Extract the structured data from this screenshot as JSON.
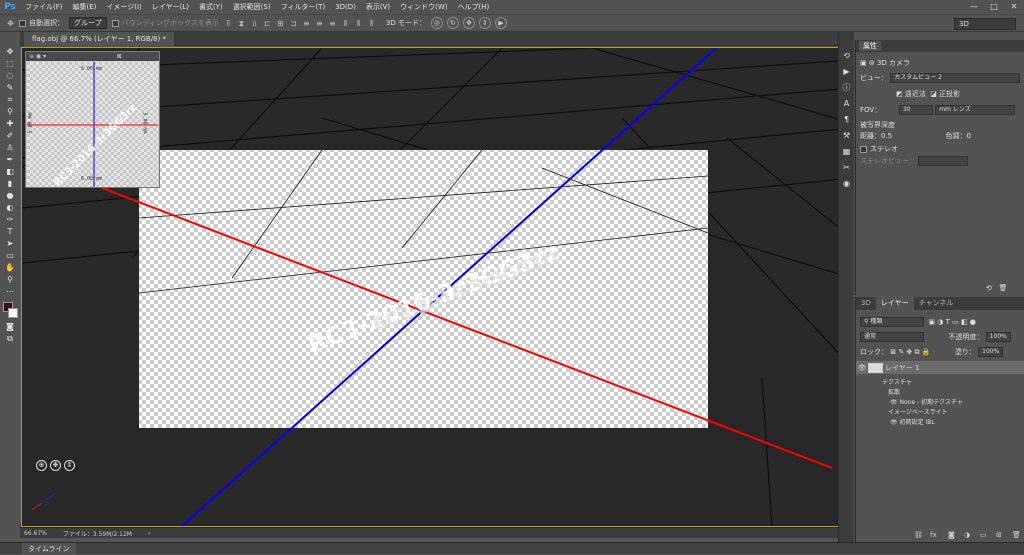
{
  "app": {
    "logo": "Ps"
  },
  "menu": [
    "ファイル(F)",
    "編集(E)",
    "イメージ(I)",
    "レイヤー(L)",
    "書式(Y)",
    "選択範囲(S)",
    "フィルター(T)",
    "3D(D)",
    "表示(V)",
    "ウィンドウ(W)",
    "ヘルプ(H)"
  ],
  "window_controls": {
    "minimize": "—",
    "maximize": "□",
    "close": "✕"
  },
  "options": {
    "auto_select": "自動選択：",
    "group": "グループ",
    "bbox": "バウンディングボックスを表示",
    "mode3d": "3D モード：",
    "workspace": "3D"
  },
  "document": {
    "tab": "flag.obj @ 66.7% (レイヤー 1, RGB/8) *",
    "text": "RC3-2016-3r3GG3rz"
  },
  "navigator": {
    "top": "6.00 mm",
    "bottom": "6.00 mm",
    "left": "5.00 mm",
    "right": "5.00 mm"
  },
  "status": {
    "zoom": "66.67%",
    "file": "ファイル：3.59M/2.12M"
  },
  "timeline": {
    "tab": "タイムライン"
  },
  "properties": {
    "tab": "属性",
    "camera": "3D カメラ",
    "view_label": "ビュー：",
    "view_value": "カスタムビュー 2",
    "persp": "遠近法",
    "ortho": "正投影",
    "fov_label": "FOV：",
    "fov_value": "30",
    "fov_unit": "mm レンズ",
    "dof": "被写界深度",
    "dist_label": "距離：0.5",
    "blur_label": "色調：0",
    "stereo": "ステレオ",
    "stereo_view": "ステレオビュー："
  },
  "layers": {
    "tabs": [
      "3D",
      "レイヤー",
      "チャンネル"
    ],
    "kind": "種類",
    "blend": "通常",
    "opacity_label": "不透明度：",
    "opacity": "100%",
    "lock": "ロック：",
    "fill_label": "塗り：",
    "fill": "100%",
    "layer_name": "レイヤー 1",
    "textures": "テクスチャ",
    "diffuse": "拡散",
    "texture1": "None - 初期テクスチャ",
    "ibl": "イメージベースライト",
    "ibl_item": "初期設定 IBL"
  }
}
